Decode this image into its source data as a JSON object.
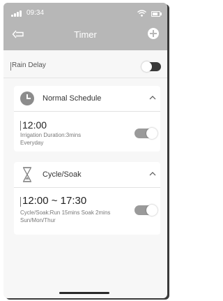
{
  "status_bar": {
    "time": "09:34"
  },
  "header": {
    "title": "Timer"
  },
  "rain_delay": {
    "label": "Rain Delay",
    "enabled": false
  },
  "schedules": [
    {
      "title": "Normal Schedule",
      "icon": "clock-icon",
      "time": "12:00",
      "detail_line1": "Irrigation Duration:3mins",
      "detail_line2": "Everyday",
      "enabled": true
    },
    {
      "title": "Cycle/Soak",
      "icon": "hourglass-icon",
      "time": "12:00 ~ 17:30",
      "detail_line1": "Cycle/Soak:Run 15mins Soak 2mins",
      "detail_line2": "Sun/Mon/Thur",
      "enabled": true
    }
  ],
  "colors": {
    "header_bg": "#b7b7b7",
    "toggle_on": "#9a9a9a",
    "toggle_off": "#3a3a3a"
  }
}
